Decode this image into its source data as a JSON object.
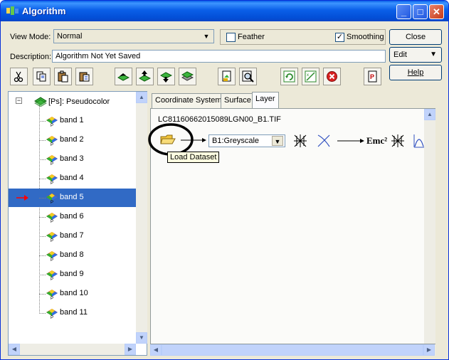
{
  "window": {
    "title": "Algorithm"
  },
  "viewmode": {
    "label": "View Mode:",
    "value": "Normal"
  },
  "feather": {
    "label": "Feather",
    "checked": false
  },
  "smoothing": {
    "label": "Smoothing",
    "checked": true,
    "mark": "✓"
  },
  "description": {
    "label": "Description:",
    "value": "Algorithm Not Yet Saved"
  },
  "buttons": {
    "close": "Close",
    "edit": "Edit",
    "help": "Help"
  },
  "toolbar": [
    "cut-icon",
    "copy-icon",
    "paste-icon",
    "paste-special-icon",
    "add-layer-icon",
    "move-layer-up-icon",
    "move-layer-down-icon",
    "layer-stack-icon",
    "load-algorithm-icon",
    "zoom-dataset-icon",
    "refresh-icon",
    "toggle-layer-icon",
    "delete-icon",
    "pdf-icon"
  ],
  "tree": {
    "root": "[Ps]: Pseudocolor",
    "items": [
      "band 1",
      "band 2",
      "band 3",
      "band 4",
      "band 5",
      "band 6",
      "band 7",
      "band 8",
      "band 9",
      "band 10",
      "band 11"
    ],
    "selected": "band 5"
  },
  "tabs": [
    "Coordinate System",
    "Surface",
    "Layer"
  ],
  "active_tab": "Layer",
  "layer": {
    "dataset": "LC81160662015089LGN00_B1.TIF",
    "band_select": "B1:Greyscale",
    "formula_label": "Emc²",
    "tooltip": "Load Dataset"
  },
  "colors": {
    "titlebar": "#0a5fe8",
    "selection": "#316ac5",
    "pointer_arrow": "#ff0000",
    "annotation": "#000000"
  }
}
